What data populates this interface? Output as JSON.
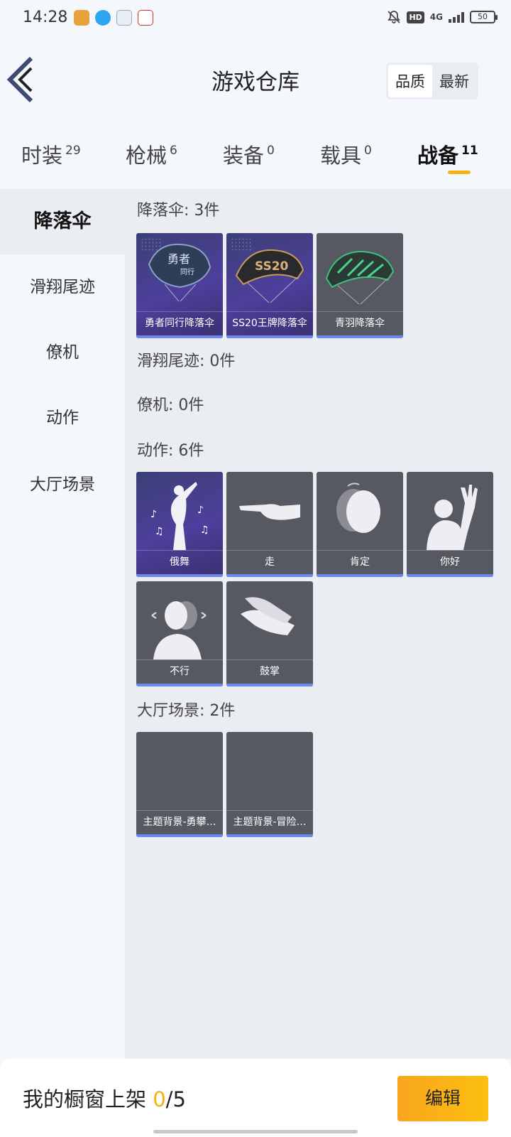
{
  "status_bar": {
    "time": "14:28",
    "hd": "HD",
    "network": "4G",
    "battery": "50",
    "icons": [
      "mute-bell-icon",
      "signal-bars-icon",
      "battery-icon"
    ]
  },
  "header": {
    "title": "游戏仓库",
    "sort_options": [
      "品质",
      "最新"
    ],
    "back_icon": "chevron-left-icon"
  },
  "tabs": [
    {
      "label": "时装",
      "count": "29"
    },
    {
      "label": "枪械",
      "count": "6"
    },
    {
      "label": "装备",
      "count": "0"
    },
    {
      "label": "载具",
      "count": "0"
    },
    {
      "label": "战备",
      "count": "11"
    }
  ],
  "sidebar": {
    "items": [
      "降落伞",
      "滑翔尾迹",
      "僚机",
      "动作",
      "大厅场景"
    ]
  },
  "sections": {
    "parachute": {
      "title": "降落伞: 3件",
      "items": [
        "勇者同行降落伞",
        "SS20王牌降落伞",
        "青羽降落伞"
      ]
    },
    "trail": {
      "title": "滑翔尾迹: 0件"
    },
    "wingman": {
      "title": "僚机: 0件"
    },
    "emote": {
      "title": "动作: 6件",
      "items": [
        "俄舞",
        "走",
        "肯定",
        "你好",
        "不行",
        "鼓掌"
      ]
    },
    "lobby": {
      "title": "大厅场景: 2件",
      "items": [
        "主题背景-勇攀…",
        "主题背景-冒险…"
      ]
    }
  },
  "bottom_bar": {
    "label": "我的橱窗上架 ",
    "count": "0",
    "total": "/5",
    "edit_label": "编辑"
  },
  "colors": {
    "accent": "#f5b111",
    "card_bar": "#6f86ef",
    "card_bg": "#575962",
    "card_purple": "#4d3f9c"
  }
}
